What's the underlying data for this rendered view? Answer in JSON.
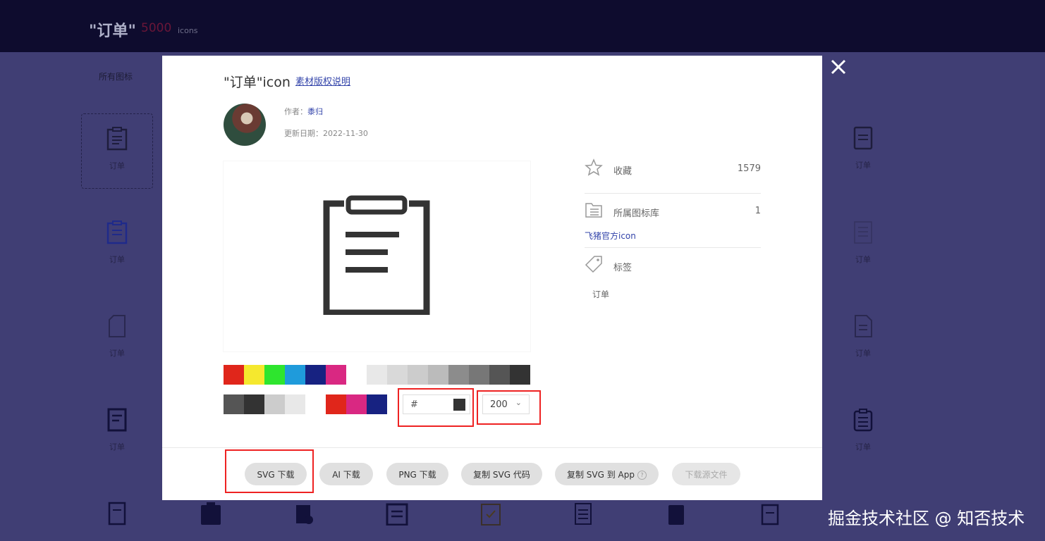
{
  "background": {
    "title": "\"订单\"",
    "count": "5000",
    "unit": "icons",
    "filter_label": "所有图标",
    "icon_label": "订单"
  },
  "modal": {
    "title": "\"订单\"icon",
    "copyright_link": "素材版权说明",
    "author_label": "作者：",
    "author_name": "黍归",
    "date_label": "更新日期：",
    "date_value": "2022-11-30",
    "preview_icon": "clipboard-list-icon",
    "palette_row1": [
      "#e0261b",
      "#f5e82e",
      "#2ee52e",
      "#1f9bdb",
      "#172281",
      "#d92882",
      "#ffffff",
      "#e8e8e8",
      "#d9d9d9",
      "#cccccc",
      "#bbbbbb",
      "#8c8c8c",
      "#777777",
      "#555555",
      "#333333"
    ],
    "palette_row2": [
      "#555555",
      "#333333",
      "#cccccc",
      "#e8e8e8",
      "#ffffff",
      "#e0261b",
      "#d92882",
      "#172281"
    ],
    "hex_label": "#",
    "current_color": "#333333",
    "size_value": "200",
    "favorite_label": "收藏",
    "favorite_count": "1579",
    "library_label": "所属图标库",
    "library_count": "1",
    "library_link": "飞猪官方icon",
    "tags_label": "标签",
    "tags": [
      "订单"
    ],
    "buttons": {
      "svg": "SVG 下载",
      "ai": "AI 下载",
      "png": "PNG 下载",
      "copy_svg": "复制 SVG 代码",
      "copy_app": "复制 SVG 到 App",
      "source": "下载源文件"
    }
  },
  "watermark": "掘金技术社区 @ 知否技术",
  "colors": {
    "accent_link": "#3344aa",
    "highlight": "#e22222",
    "overlay": "#403e74"
  }
}
